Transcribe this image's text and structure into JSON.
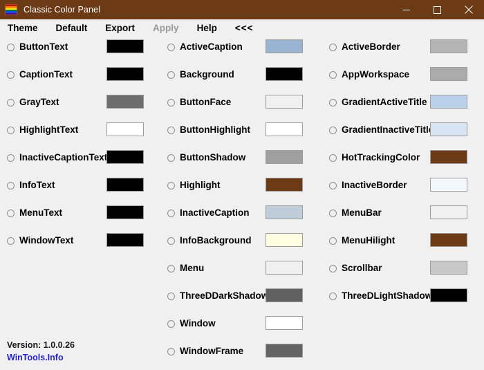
{
  "window": {
    "title": "Classic Color Panel",
    "titlebar_color": "#6d3a16",
    "titlebar_text_color": "#ffffff",
    "client_background": "#f0f0f0",
    "icon": "rainbow-flag-icon",
    "icon_stripes": [
      "#e50000",
      "#ff8d00",
      "#ffee00",
      "#028121",
      "#004cff",
      "#770088"
    ],
    "controls": {
      "minimize": "minimize-icon",
      "maximize": "maximize-icon",
      "close": "close-icon"
    }
  },
  "menubar": {
    "items": [
      {
        "label": "Theme",
        "disabled": false
      },
      {
        "label": "Default",
        "disabled": false
      },
      {
        "label": "Export",
        "disabled": false
      },
      {
        "label": "Apply",
        "disabled": true
      },
      {
        "label": "Help",
        "disabled": false
      },
      {
        "label": "<<<",
        "disabled": false
      }
    ]
  },
  "columns": [
    {
      "id": "column-1",
      "rows": [
        {
          "label": "ButtonText",
          "color": "#000000",
          "selected": false
        },
        {
          "label": "CaptionText",
          "color": "#000000",
          "selected": false
        },
        {
          "label": "GrayText",
          "color": "#6d6d6d",
          "selected": false
        },
        {
          "label": "HighlightText",
          "color": "#ffffff",
          "selected": false
        },
        {
          "label": "InactiveCaptionText",
          "color": "#000000",
          "selected": false
        },
        {
          "label": "InfoText",
          "color": "#000000",
          "selected": false
        },
        {
          "label": "MenuText",
          "color": "#000000",
          "selected": false
        },
        {
          "label": "WindowText",
          "color": "#000000",
          "selected": false
        }
      ]
    },
    {
      "id": "column-2",
      "rows": [
        {
          "label": "ActiveCaption",
          "color": "#99b4d1",
          "selected": false
        },
        {
          "label": "Background",
          "color": "#000000",
          "selected": false
        },
        {
          "label": "ButtonFace",
          "color": "#f0f0f0",
          "selected": false
        },
        {
          "label": "ButtonHighlight",
          "color": "#ffffff",
          "selected": false
        },
        {
          "label": "ButtonShadow",
          "color": "#a0a0a0",
          "selected": false
        },
        {
          "label": "Highlight",
          "color": "#6d3a16",
          "selected": false
        },
        {
          "label": "InactiveCaption",
          "color": "#bfcddb",
          "selected": false
        },
        {
          "label": "InfoBackground",
          "color": "#ffffe1",
          "selected": false
        },
        {
          "label": "Menu",
          "color": "#f0f0f0",
          "selected": false
        },
        {
          "label": "ThreeDDarkShadow",
          "color": "#606060",
          "selected": false
        },
        {
          "label": "Window",
          "color": "#ffffff",
          "selected": false
        },
        {
          "label": "WindowFrame",
          "color": "#646464",
          "selected": false
        }
      ]
    },
    {
      "id": "column-3",
      "rows": [
        {
          "label": "ActiveBorder",
          "color": "#b4b4b4",
          "selected": false
        },
        {
          "label": "AppWorkspace",
          "color": "#ababab",
          "selected": false
        },
        {
          "label": "GradientActiveTitle",
          "color": "#b9d1ea",
          "selected": false
        },
        {
          "label": "GradientInactiveTitle",
          "color": "#d7e4f2",
          "selected": false
        },
        {
          "label": "HotTrackingColor",
          "color": "#6d3a16",
          "selected": false
        },
        {
          "label": "InactiveBorder",
          "color": "#f4f7fc",
          "selected": false
        },
        {
          "label": "MenuBar",
          "color": "#f0f0f0",
          "selected": false
        },
        {
          "label": "MenuHilight",
          "color": "#6d3a16",
          "selected": false
        },
        {
          "label": "Scrollbar",
          "color": "#c8c8c8",
          "selected": false
        },
        {
          "label": "ThreeDLightShadow",
          "color": "#000000",
          "selected": false
        }
      ]
    }
  ],
  "footer": {
    "version": "Version: 1.0.0.26",
    "link": "WinTools.Info",
    "link_color": "#2222dd"
  }
}
